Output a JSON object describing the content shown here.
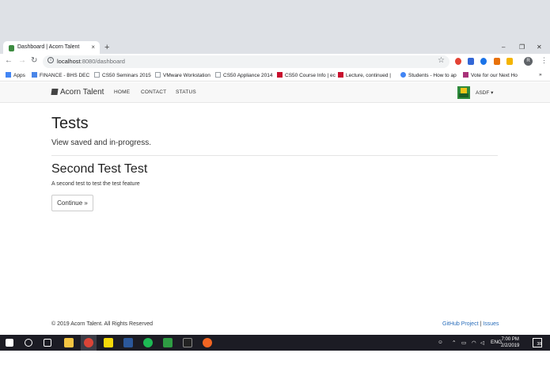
{
  "browser": {
    "tab_title": "Dashboard | Acorn Talent",
    "tab_close": "×",
    "new_tab": "+",
    "window_controls": {
      "minimize": "–",
      "restore": "❐",
      "close": "✕"
    },
    "url_host": "localhost",
    "url_path": ":8080/dashboard",
    "profile_initial": "R",
    "bookmarks": [
      {
        "label": "Apps",
        "icon": "apps-grid-icon",
        "color": "#4285f4"
      },
      {
        "label": "FINANCE - BHS DEC",
        "icon": "bookmark-icon",
        "color": "#4a86e8"
      },
      {
        "label": "CS50 Seminars 2015",
        "icon": "page-icon",
        "color": "#9aa0a6"
      },
      {
        "label": "VMware Workstation",
        "icon": "page-icon",
        "color": "#9aa0a6"
      },
      {
        "label": "CS50 Appliance 2014",
        "icon": "page-icon",
        "color": "#9aa0a6"
      },
      {
        "label": "CS50 Course Info | ec",
        "icon": "edx-icon",
        "color": "#c8102e"
      },
      {
        "label": "Lecture, continued |",
        "icon": "edx-icon",
        "color": "#c8102e"
      },
      {
        "label": "Students - How to ap",
        "icon": "google-icon",
        "color": "#4285f4"
      },
      {
        "label": "Vote for our Next Ho",
        "icon": "bookmark-icon",
        "color": "#a83279"
      }
    ],
    "more_bookmarks": "»"
  },
  "site": {
    "brand": "Acorn Talent",
    "nav": [
      "HOME",
      "CONTACT",
      "STATUS"
    ],
    "user_menu": "ASDF ▾"
  },
  "main": {
    "title": "Tests",
    "lead": "View saved and in-progress.",
    "test_title": "Second Test Test",
    "test_description": "A second test to test the test feature",
    "continue_button": "Continue »"
  },
  "footer": {
    "copyright": "© 2019 Acorn Talent. All Rights Reserved",
    "github": "GitHub Project",
    "issues": "Issues"
  },
  "taskbar": {
    "lang": "ENG",
    "time": "7:00 PM",
    "date": "2/2/2019",
    "notifications": "38",
    "accent_colors": {
      "explorer": "#f4c542",
      "chrome": "#db4437",
      "sticky": "#f5d90a",
      "word": "#2b579a",
      "spotify": "#1db954",
      "git": "#2e9c43",
      "terminal": "#222222",
      "app": "#f26522"
    }
  }
}
